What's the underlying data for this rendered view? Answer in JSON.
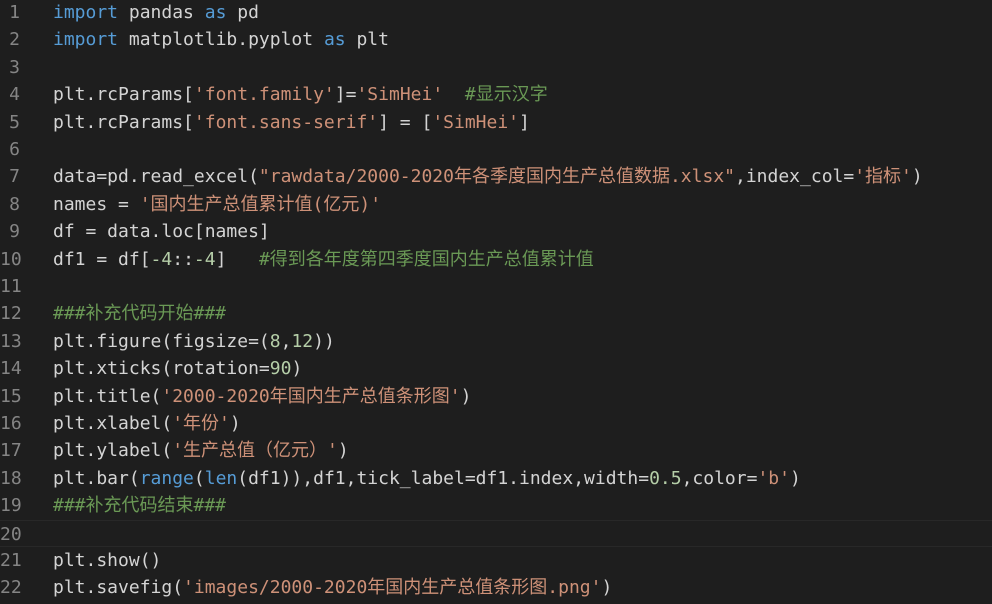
{
  "editor": {
    "colors": {
      "background": "#1e1e1e",
      "keyword": "#c586c0",
      "builtin": "#569cd6",
      "string": "#ce9178",
      "number": "#b5cea8",
      "comment": "#6a9955",
      "text": "#d4d4d4",
      "line_number": "#858585"
    },
    "current_line": 20,
    "lines": [
      {
        "n": "1",
        "tokens": [
          {
            "t": "import",
            "c": "kw2"
          },
          {
            "t": " pandas ",
            "c": "def"
          },
          {
            "t": "as",
            "c": "kw2"
          },
          {
            "t": " pd",
            "c": "def"
          }
        ]
      },
      {
        "n": "2",
        "tokens": [
          {
            "t": "import",
            "c": "kw2"
          },
          {
            "t": " matplotlib.pyplot ",
            "c": "def"
          },
          {
            "t": "as",
            "c": "kw2"
          },
          {
            "t": " plt",
            "c": "def"
          }
        ]
      },
      {
        "n": "3",
        "tokens": []
      },
      {
        "n": "4",
        "tokens": [
          {
            "t": "plt.rcParams[",
            "c": "def"
          },
          {
            "t": "'font.family'",
            "c": "str"
          },
          {
            "t": "]=",
            "c": "def"
          },
          {
            "t": "'SimHei'",
            "c": "str"
          },
          {
            "t": "  ",
            "c": "def"
          },
          {
            "t": "#显示汉字",
            "c": "cm"
          }
        ]
      },
      {
        "n": "5",
        "tokens": [
          {
            "t": "plt.rcParams[",
            "c": "def"
          },
          {
            "t": "'font.sans-serif'",
            "c": "str"
          },
          {
            "t": "] = [",
            "c": "def"
          },
          {
            "t": "'SimHei'",
            "c": "str"
          },
          {
            "t": "]",
            "c": "def"
          }
        ]
      },
      {
        "n": "6",
        "tokens": []
      },
      {
        "n": "7",
        "tokens": [
          {
            "t": "data=pd.read_excel(",
            "c": "def"
          },
          {
            "t": "\"rawdata/2000-2020年各季度国内生产总值数据.xlsx\"",
            "c": "str"
          },
          {
            "t": ",index_col=",
            "c": "def"
          },
          {
            "t": "'指标'",
            "c": "str"
          },
          {
            "t": ")",
            "c": "def"
          }
        ]
      },
      {
        "n": "8",
        "tokens": [
          {
            "t": "names = ",
            "c": "def"
          },
          {
            "t": "'国内生产总值累计值(亿元)'",
            "c": "str"
          }
        ]
      },
      {
        "n": "9",
        "tokens": [
          {
            "t": "df = data.loc[names]",
            "c": "def"
          }
        ]
      },
      {
        "n": "10",
        "tokens": [
          {
            "t": "df1 = df[",
            "c": "def"
          },
          {
            "t": "-4",
            "c": "num"
          },
          {
            "t": "::",
            "c": "def"
          },
          {
            "t": "-4",
            "c": "num"
          },
          {
            "t": "]   ",
            "c": "def"
          },
          {
            "t": "#得到各年度第四季度国内生产总值累计值",
            "c": "cm"
          }
        ]
      },
      {
        "n": "11",
        "tokens": []
      },
      {
        "n": "12",
        "tokens": [
          {
            "t": "###补充代码开始###",
            "c": "cm"
          }
        ]
      },
      {
        "n": "13",
        "tokens": [
          {
            "t": "plt.figure(figsize=(",
            "c": "def"
          },
          {
            "t": "8",
            "c": "num"
          },
          {
            "t": ",",
            "c": "def"
          },
          {
            "t": "12",
            "c": "num"
          },
          {
            "t": "))",
            "c": "def"
          }
        ]
      },
      {
        "n": "14",
        "tokens": [
          {
            "t": "plt.xticks(rotation=",
            "c": "def"
          },
          {
            "t": "90",
            "c": "num"
          },
          {
            "t": ")",
            "c": "def"
          }
        ]
      },
      {
        "n": "15",
        "tokens": [
          {
            "t": "plt.title(",
            "c": "def"
          },
          {
            "t": "'2000-2020年国内生产总值条形图'",
            "c": "str"
          },
          {
            "t": ")",
            "c": "def"
          }
        ]
      },
      {
        "n": "16",
        "tokens": [
          {
            "t": "plt.xlabel(",
            "c": "def"
          },
          {
            "t": "'年份'",
            "c": "str"
          },
          {
            "t": ")",
            "c": "def"
          }
        ]
      },
      {
        "n": "17",
        "tokens": [
          {
            "t": "plt.ylabel(",
            "c": "def"
          },
          {
            "t": "'生产总值（亿元）'",
            "c": "str"
          },
          {
            "t": ")",
            "c": "def"
          }
        ]
      },
      {
        "n": "18",
        "tokens": [
          {
            "t": "plt.bar(",
            "c": "def"
          },
          {
            "t": "range",
            "c": "kw2"
          },
          {
            "t": "(",
            "c": "def"
          },
          {
            "t": "len",
            "c": "kw2"
          },
          {
            "t": "(df1)),df1,tick_label=df1.index,width=",
            "c": "def"
          },
          {
            "t": "0.5",
            "c": "num"
          },
          {
            "t": ",color=",
            "c": "def"
          },
          {
            "t": "'b'",
            "c": "str"
          },
          {
            "t": ")",
            "c": "def"
          }
        ]
      },
      {
        "n": "19",
        "tokens": [
          {
            "t": "###补充代码结束###",
            "c": "cm"
          }
        ]
      },
      {
        "n": "20",
        "tokens": []
      },
      {
        "n": "21",
        "tokens": [
          {
            "t": "plt.show()",
            "c": "def"
          }
        ]
      },
      {
        "n": "22",
        "tokens": [
          {
            "t": "plt.savefig(",
            "c": "def"
          },
          {
            "t": "'images/2000-2020年国内生产总值条形图.png'",
            "c": "str"
          },
          {
            "t": ")",
            "c": "def"
          }
        ]
      }
    ]
  }
}
